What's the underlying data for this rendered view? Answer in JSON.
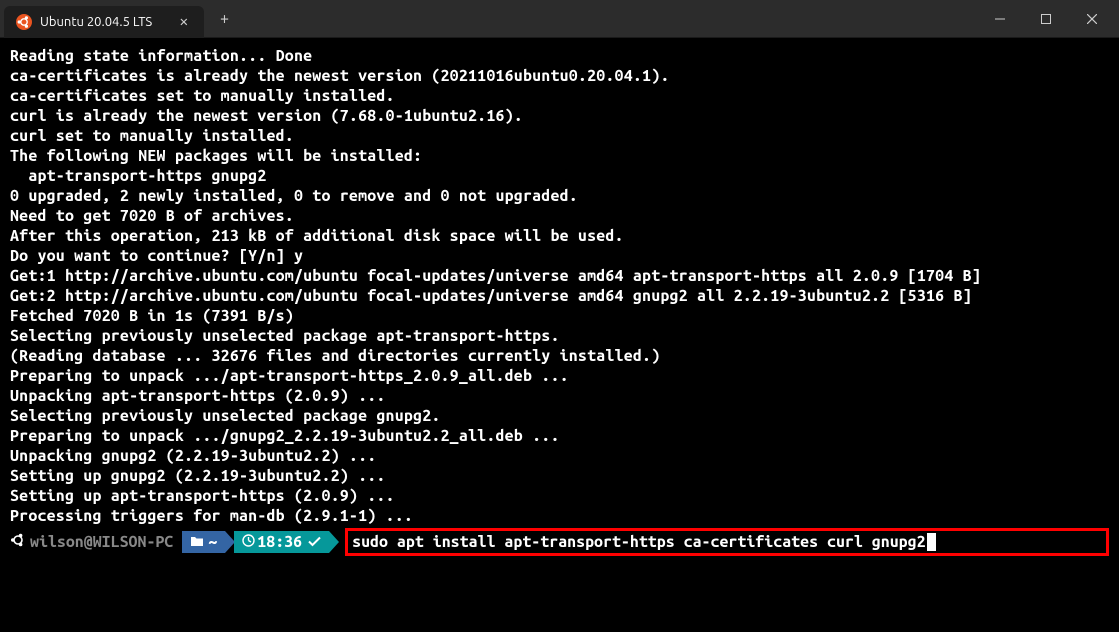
{
  "window": {
    "tab_title": "Ubuntu 20.04.5 LTS"
  },
  "terminal": {
    "lines": [
      "Reading state information... Done",
      "ca-certificates is already the newest version (20211016ubuntu0.20.04.1).",
      "ca-certificates set to manually installed.",
      "curl is already the newest version (7.68.0-1ubuntu2.16).",
      "curl set to manually installed.",
      "The following NEW packages will be installed:",
      "  apt-transport-https gnupg2",
      "0 upgraded, 2 newly installed, 0 to remove and 0 not upgraded.",
      "Need to get 7020 B of archives.",
      "After this operation, 213 kB of additional disk space will be used.",
      "Do you want to continue? [Y/n] y",
      "Get:1 http://archive.ubuntu.com/ubuntu focal-updates/universe amd64 apt-transport-https all 2.0.9 [1704 B]",
      "Get:2 http://archive.ubuntu.com/ubuntu focal-updates/universe amd64 gnupg2 all 2.2.19-3ubuntu2.2 [5316 B]",
      "Fetched 7020 B in 1s (7391 B/s)",
      "Selecting previously unselected package apt-transport-https.",
      "(Reading database ... 32676 files and directories currently installed.)",
      "Preparing to unpack .../apt-transport-https_2.0.9_all.deb ...",
      "Unpacking apt-transport-https (2.0.9) ...",
      "Selecting previously unselected package gnupg2.",
      "Preparing to unpack .../gnupg2_2.2.19-3ubuntu2.2_all.deb ...",
      "Unpacking gnupg2 (2.2.19-3ubuntu2.2) ...",
      "Setting up gnupg2 (2.2.19-3ubuntu2.2) ...",
      "Setting up apt-transport-https (2.0.9) ...",
      "Processing triggers for man-db (2.9.1-1) ..."
    ]
  },
  "prompt": {
    "user_host": "wilson@WILSON-PC ",
    "cwd": "~",
    "time": "18:36",
    "command": "sudo apt install apt-transport-https ca-certificates curl gnupg2"
  }
}
